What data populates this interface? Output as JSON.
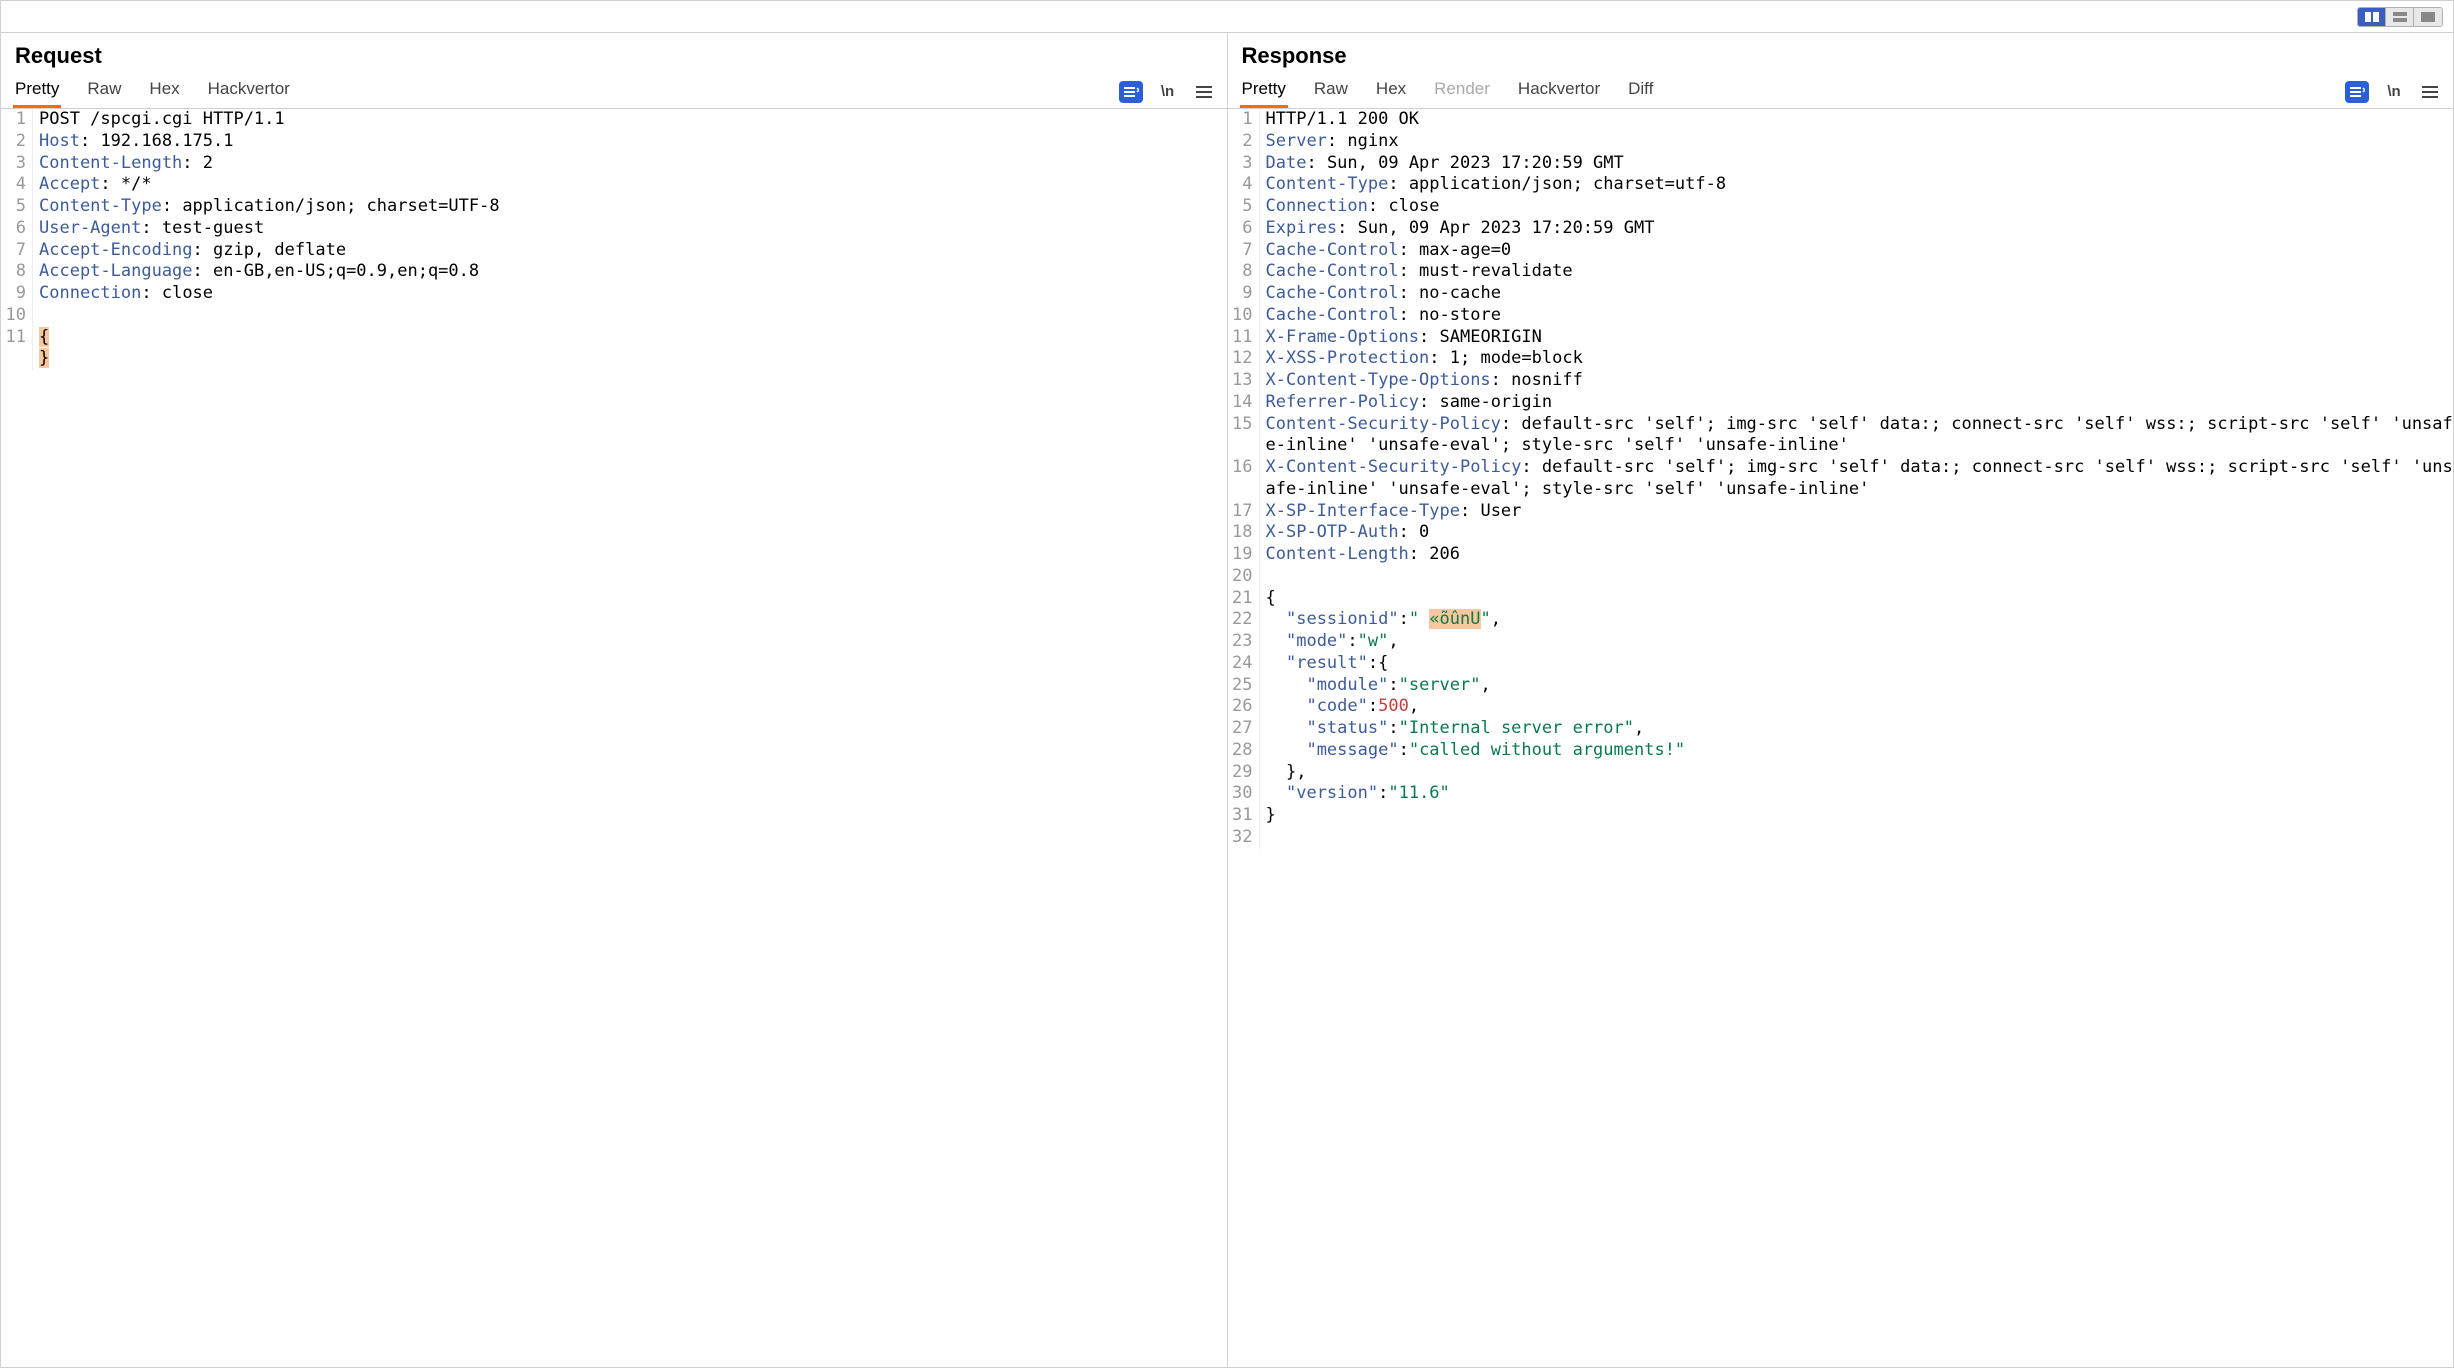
{
  "topToolbar": {
    "layoutActive": 0
  },
  "request": {
    "title": "Request",
    "tabs": [
      "Pretty",
      "Raw",
      "Hex",
      "Hackvertor"
    ],
    "activeTab": 0,
    "toolbar": {
      "wrap": "\\n"
    },
    "lines": [
      {
        "n": 1,
        "type": "startline",
        "content": "POST /spcgi.cgi HTTP/1.1"
      },
      {
        "n": 2,
        "type": "header",
        "key": "Host",
        "value": "192.168.175.1"
      },
      {
        "n": 3,
        "type": "header",
        "key": "Content-Length",
        "value": "2"
      },
      {
        "n": 4,
        "type": "header",
        "key": "Accept",
        "value": "*/*"
      },
      {
        "n": 5,
        "type": "header",
        "key": "Content-Type",
        "value": "application/json; charset=UTF-8"
      },
      {
        "n": 6,
        "type": "header",
        "key": "User-Agent",
        "value": "test-guest"
      },
      {
        "n": 7,
        "type": "header",
        "key": "Accept-Encoding",
        "value": "gzip, deflate"
      },
      {
        "n": 8,
        "type": "header",
        "key": "Accept-Language",
        "value": "en-GB,en-US;q=0.9,en;q=0.8"
      },
      {
        "n": 9,
        "type": "header",
        "key": "Connection",
        "value": "close"
      },
      {
        "n": 10,
        "type": "blank"
      },
      {
        "n": 11,
        "type": "bracestack",
        "braces": [
          "{",
          "}"
        ]
      }
    ]
  },
  "response": {
    "title": "Response",
    "tabs": [
      "Pretty",
      "Raw",
      "Hex",
      "Render",
      "Hackvertor",
      "Diff"
    ],
    "activeTab": 0,
    "disabledTabs": [
      3
    ],
    "toolbar": {
      "wrap": "\\n"
    },
    "lines": [
      {
        "n": 1,
        "type": "startline",
        "content": "HTTP/1.1 200 OK"
      },
      {
        "n": 2,
        "type": "header",
        "key": "Server",
        "value": "nginx"
      },
      {
        "n": 3,
        "type": "header",
        "key": "Date",
        "value": "Sun, 09 Apr 2023 17:20:59 GMT"
      },
      {
        "n": 4,
        "type": "header",
        "key": "Content-Type",
        "value": "application/json; charset=utf-8"
      },
      {
        "n": 5,
        "type": "header",
        "key": "Connection",
        "value": "close"
      },
      {
        "n": 6,
        "type": "header",
        "key": "Expires",
        "value": "Sun, 09 Apr 2023 17:20:59 GMT"
      },
      {
        "n": 7,
        "type": "header",
        "key": "Cache-Control",
        "value": "max-age=0"
      },
      {
        "n": 8,
        "type": "header",
        "key": "Cache-Control",
        "value": "must-revalidate"
      },
      {
        "n": 9,
        "type": "header",
        "key": "Cache-Control",
        "value": "no-cache"
      },
      {
        "n": 10,
        "type": "header",
        "key": "Cache-Control",
        "value": "no-store"
      },
      {
        "n": 11,
        "type": "header",
        "key": "X-Frame-Options",
        "value": "SAMEORIGIN"
      },
      {
        "n": 12,
        "type": "header",
        "key": "X-XSS-Protection",
        "value": "1; mode=block"
      },
      {
        "n": 13,
        "type": "header",
        "key": "X-Content-Type-Options",
        "value": "nosniff"
      },
      {
        "n": 14,
        "type": "header",
        "key": "Referrer-Policy",
        "value": "same-origin"
      },
      {
        "n": 15,
        "type": "header",
        "key": "Content-Security-Policy",
        "value": "default-src 'self'; img-src 'self' data:; connect-src 'self' wss:; script-src 'self' 'unsafe-inline' 'unsafe-eval'; style-src 'self' 'unsafe-inline'"
      },
      {
        "n": 16,
        "type": "header",
        "key": "X-Content-Security-Policy",
        "value": "default-src 'self'; img-src 'self' data:; connect-src 'self' wss:; script-src 'self' 'unsafe-inline' 'unsafe-eval'; style-src 'self' 'unsafe-inline'"
      },
      {
        "n": 17,
        "type": "header",
        "key": "X-SP-Interface-Type",
        "value": "User"
      },
      {
        "n": 18,
        "type": "header",
        "key": "X-SP-OTP-Auth",
        "value": "0"
      },
      {
        "n": 19,
        "type": "header",
        "key": "Content-Length",
        "value": "206"
      },
      {
        "n": 20,
        "type": "blank"
      },
      {
        "n": 21,
        "type": "json",
        "indent": 0,
        "nodes": [
          {
            "t": "punc",
            "v": "{"
          }
        ]
      },
      {
        "n": 22,
        "type": "json",
        "indent": 1,
        "nodes": [
          {
            "t": "key",
            "v": "\"sessionid\""
          },
          {
            "t": "punc",
            "v": ":"
          },
          {
            "t": "str",
            "v": "\" "
          },
          {
            "t": "hlstr",
            "v": "«õûnU"
          },
          {
            "t": "str",
            "v": "\""
          },
          {
            "t": "punc",
            "v": ","
          }
        ]
      },
      {
        "n": 23,
        "type": "json",
        "indent": 1,
        "nodes": [
          {
            "t": "key",
            "v": "\"mode\""
          },
          {
            "t": "punc",
            "v": ":"
          },
          {
            "t": "str",
            "v": "\"w\""
          },
          {
            "t": "punc",
            "v": ","
          }
        ]
      },
      {
        "n": 24,
        "type": "json",
        "indent": 1,
        "nodes": [
          {
            "t": "key",
            "v": "\"result\""
          },
          {
            "t": "punc",
            "v": ":{"
          }
        ]
      },
      {
        "n": 25,
        "type": "json",
        "indent": 2,
        "nodes": [
          {
            "t": "key",
            "v": "\"module\""
          },
          {
            "t": "punc",
            "v": ":"
          },
          {
            "t": "str",
            "v": "\"server\""
          },
          {
            "t": "punc",
            "v": ","
          }
        ]
      },
      {
        "n": 26,
        "type": "json",
        "indent": 2,
        "nodes": [
          {
            "t": "key",
            "v": "\"code\""
          },
          {
            "t": "punc",
            "v": ":"
          },
          {
            "t": "num",
            "v": "500"
          },
          {
            "t": "punc",
            "v": ","
          }
        ]
      },
      {
        "n": 27,
        "type": "json",
        "indent": 2,
        "nodes": [
          {
            "t": "key",
            "v": "\"status\""
          },
          {
            "t": "punc",
            "v": ":"
          },
          {
            "t": "str",
            "v": "\"Internal server error\""
          },
          {
            "t": "punc",
            "v": ","
          }
        ]
      },
      {
        "n": 28,
        "type": "json",
        "indent": 2,
        "nodes": [
          {
            "t": "key",
            "v": "\"message\""
          },
          {
            "t": "punc",
            "v": ":"
          },
          {
            "t": "str",
            "v": "\"called without arguments!\""
          }
        ]
      },
      {
        "n": 29,
        "type": "json",
        "indent": 1,
        "nodes": [
          {
            "t": "punc",
            "v": "},"
          }
        ]
      },
      {
        "n": 30,
        "type": "json",
        "indent": 1,
        "nodes": [
          {
            "t": "key",
            "v": "\"version\""
          },
          {
            "t": "punc",
            "v": ":"
          },
          {
            "t": "str",
            "v": "\"11.6\""
          }
        ]
      },
      {
        "n": 31,
        "type": "json",
        "indent": 0,
        "nodes": [
          {
            "t": "punc",
            "v": "}"
          }
        ]
      },
      {
        "n": 32,
        "type": "blank"
      }
    ]
  }
}
